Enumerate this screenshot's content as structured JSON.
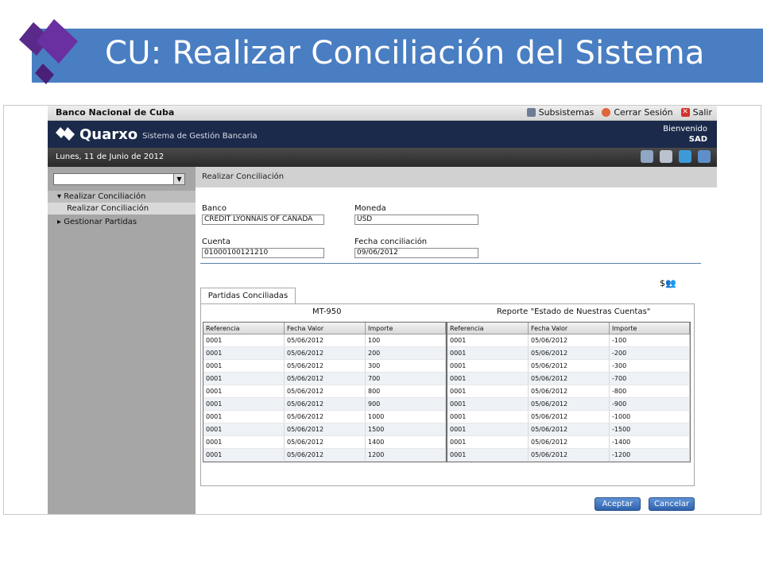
{
  "slide": {
    "title": "CU: Realizar Conciliación del Sistema"
  },
  "app": {
    "bank_name": "Banco Nacional de Cuba",
    "top_links": [
      "Subsistemas",
      "Cerrar Sesión",
      "Salir"
    ],
    "brand_name": "Quarxo",
    "brand_sub": "Sistema de Gestión Bancaria",
    "welcome_label": "Bienvenido",
    "user": "SAD",
    "date": "Lunes, 11 de Junio de 2012"
  },
  "sidebar": {
    "menu_group": "Realizar Conciliación",
    "menu_sub": "Realizar Conciliación",
    "menu_other": "Gestionar Partidas"
  },
  "form": {
    "header": "Realizar Conciliación",
    "banco_label": "Banco",
    "banco_value": "CREDIT LYONNAIS OF CANADA",
    "moneda_label": "Moneda",
    "moneda_value": "USD",
    "cuenta_label": "Cuenta",
    "cuenta_value": "01000100121210",
    "fecha_label": "Fecha conciliación",
    "fecha_value": "09/06/2012"
  },
  "tab": {
    "label": "Partidas Conciliadas"
  },
  "grids": {
    "left_title": "MT-950",
    "right_title": "Reporte \"Estado de Nuestras Cuentas\"",
    "columns": [
      "Referencia",
      "Fecha Valor",
      "Importe"
    ],
    "left_rows": [
      [
        "0001",
        "05/06/2012",
        "100"
      ],
      [
        "0001",
        "05/06/2012",
        "200"
      ],
      [
        "0001",
        "05/06/2012",
        "300"
      ],
      [
        "0001",
        "05/06/2012",
        "700"
      ],
      [
        "0001",
        "05/06/2012",
        "800"
      ],
      [
        "0001",
        "05/06/2012",
        "900"
      ],
      [
        "0001",
        "05/06/2012",
        "1000"
      ],
      [
        "0001",
        "05/06/2012",
        "1500"
      ],
      [
        "0001",
        "05/06/2012",
        "1400"
      ],
      [
        "0001",
        "05/06/2012",
        "1200"
      ]
    ],
    "right_rows": [
      [
        "0001",
        "05/06/2012",
        "-100"
      ],
      [
        "0001",
        "05/06/2012",
        "-200"
      ],
      [
        "0001",
        "05/06/2012",
        "-300"
      ],
      [
        "0001",
        "05/06/2012",
        "-700"
      ],
      [
        "0001",
        "05/06/2012",
        "-800"
      ],
      [
        "0001",
        "05/06/2012",
        "-900"
      ],
      [
        "0001",
        "05/06/2012",
        "-1000"
      ],
      [
        "0001",
        "05/06/2012",
        "-1500"
      ],
      [
        "0001",
        "05/06/2012",
        "-1400"
      ],
      [
        "0001",
        "05/06/2012",
        "-1200"
      ]
    ]
  },
  "buttons": {
    "accept": "Aceptar",
    "cancel": "Cancelar"
  },
  "colors": {
    "slide_band": "#4a7ec2",
    "brand_bar": "#1b2a4a",
    "button": "#2f62ad"
  }
}
